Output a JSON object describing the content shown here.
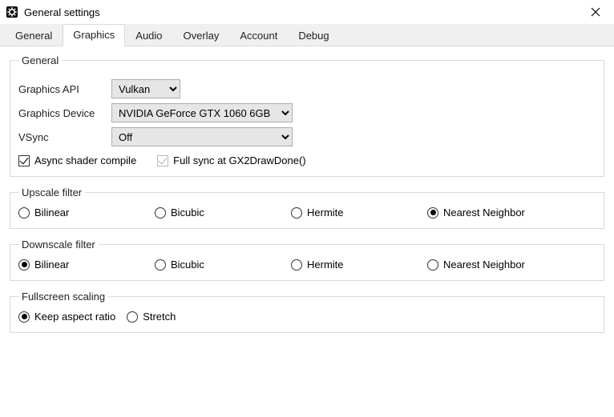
{
  "window": {
    "title": "General settings"
  },
  "tabs": [
    "General",
    "Graphics",
    "Audio",
    "Overlay",
    "Account",
    "Debug"
  ],
  "active_tab": 1,
  "groups": {
    "general": {
      "legend": "General",
      "api_label": "Graphics API",
      "api_value": "Vulkan",
      "device_label": "Graphics Device",
      "device_value": "NVIDIA GeForce GTX 1060 6GB",
      "vsync_label": "VSync",
      "vsync_value": "Off",
      "async_label": "Async shader compile",
      "async_checked": true,
      "fullsync_label": "Full sync at GX2DrawDone()",
      "fullsync_checked": true,
      "fullsync_disabled": true
    },
    "upscale": {
      "legend": "Upscale filter",
      "options": [
        "Bilinear",
        "Bicubic",
        "Hermite",
        "Nearest Neighbor"
      ],
      "selected": 3
    },
    "downscale": {
      "legend": "Downscale filter",
      "options": [
        "Bilinear",
        "Bicubic",
        "Hermite",
        "Nearest Neighbor"
      ],
      "selected": 0
    },
    "fullscreen": {
      "legend": "Fullscreen scaling",
      "options": [
        "Keep aspect ratio",
        "Stretch"
      ],
      "selected": 0
    }
  }
}
